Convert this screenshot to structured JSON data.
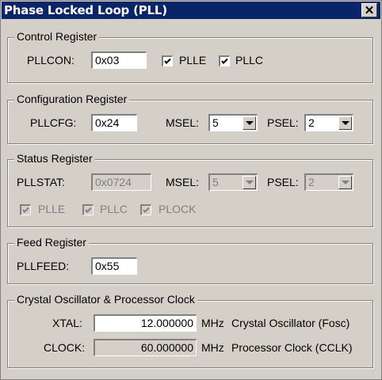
{
  "window": {
    "title": "Phase Locked Loop (PLL)",
    "close_glyph": "✕"
  },
  "control": {
    "legend": "Control Register",
    "pllcon_label": "PLLCON:",
    "pllcon_value": "0x03",
    "plle_label": "PLLE",
    "plle_checked": true,
    "pllc_label": "PLLC",
    "pllc_checked": true
  },
  "configuration": {
    "legend": "Configuration Register",
    "pllcfg_label": "PLLCFG:",
    "pllcfg_value": "0x24",
    "msel_label": "MSEL:",
    "msel_value": "5",
    "psel_label": "PSEL:",
    "psel_value": "2"
  },
  "status": {
    "legend": "Status Register",
    "pllstat_label": "PLLSTAT:",
    "pllstat_value": "0x0724",
    "msel_label": "MSEL:",
    "msel_value": "5",
    "psel_label": "PSEL:",
    "psel_value": "2",
    "plle_label": "PLLE",
    "pllc_label": "PLLC",
    "plock_label": "PLOCK"
  },
  "feed": {
    "legend": "Feed Register",
    "pllfeed_label": "PLLFEED:",
    "pllfeed_value": "0x55"
  },
  "clock": {
    "legend": "Crystal Oscillator & Processor Clock",
    "xtal_label": "XTAL:",
    "xtal_value": "12.000000",
    "xtal_unit": "MHz",
    "xtal_desc": "Crystal Oscillator (Fosc)",
    "clock_label": "CLOCK:",
    "clock_value": "60.000000",
    "clock_unit": "MHz",
    "clock_desc": "Processor Clock (CCLK)"
  },
  "colors": {
    "titlebar": "#0a246a",
    "face": "#d4d0c8"
  }
}
